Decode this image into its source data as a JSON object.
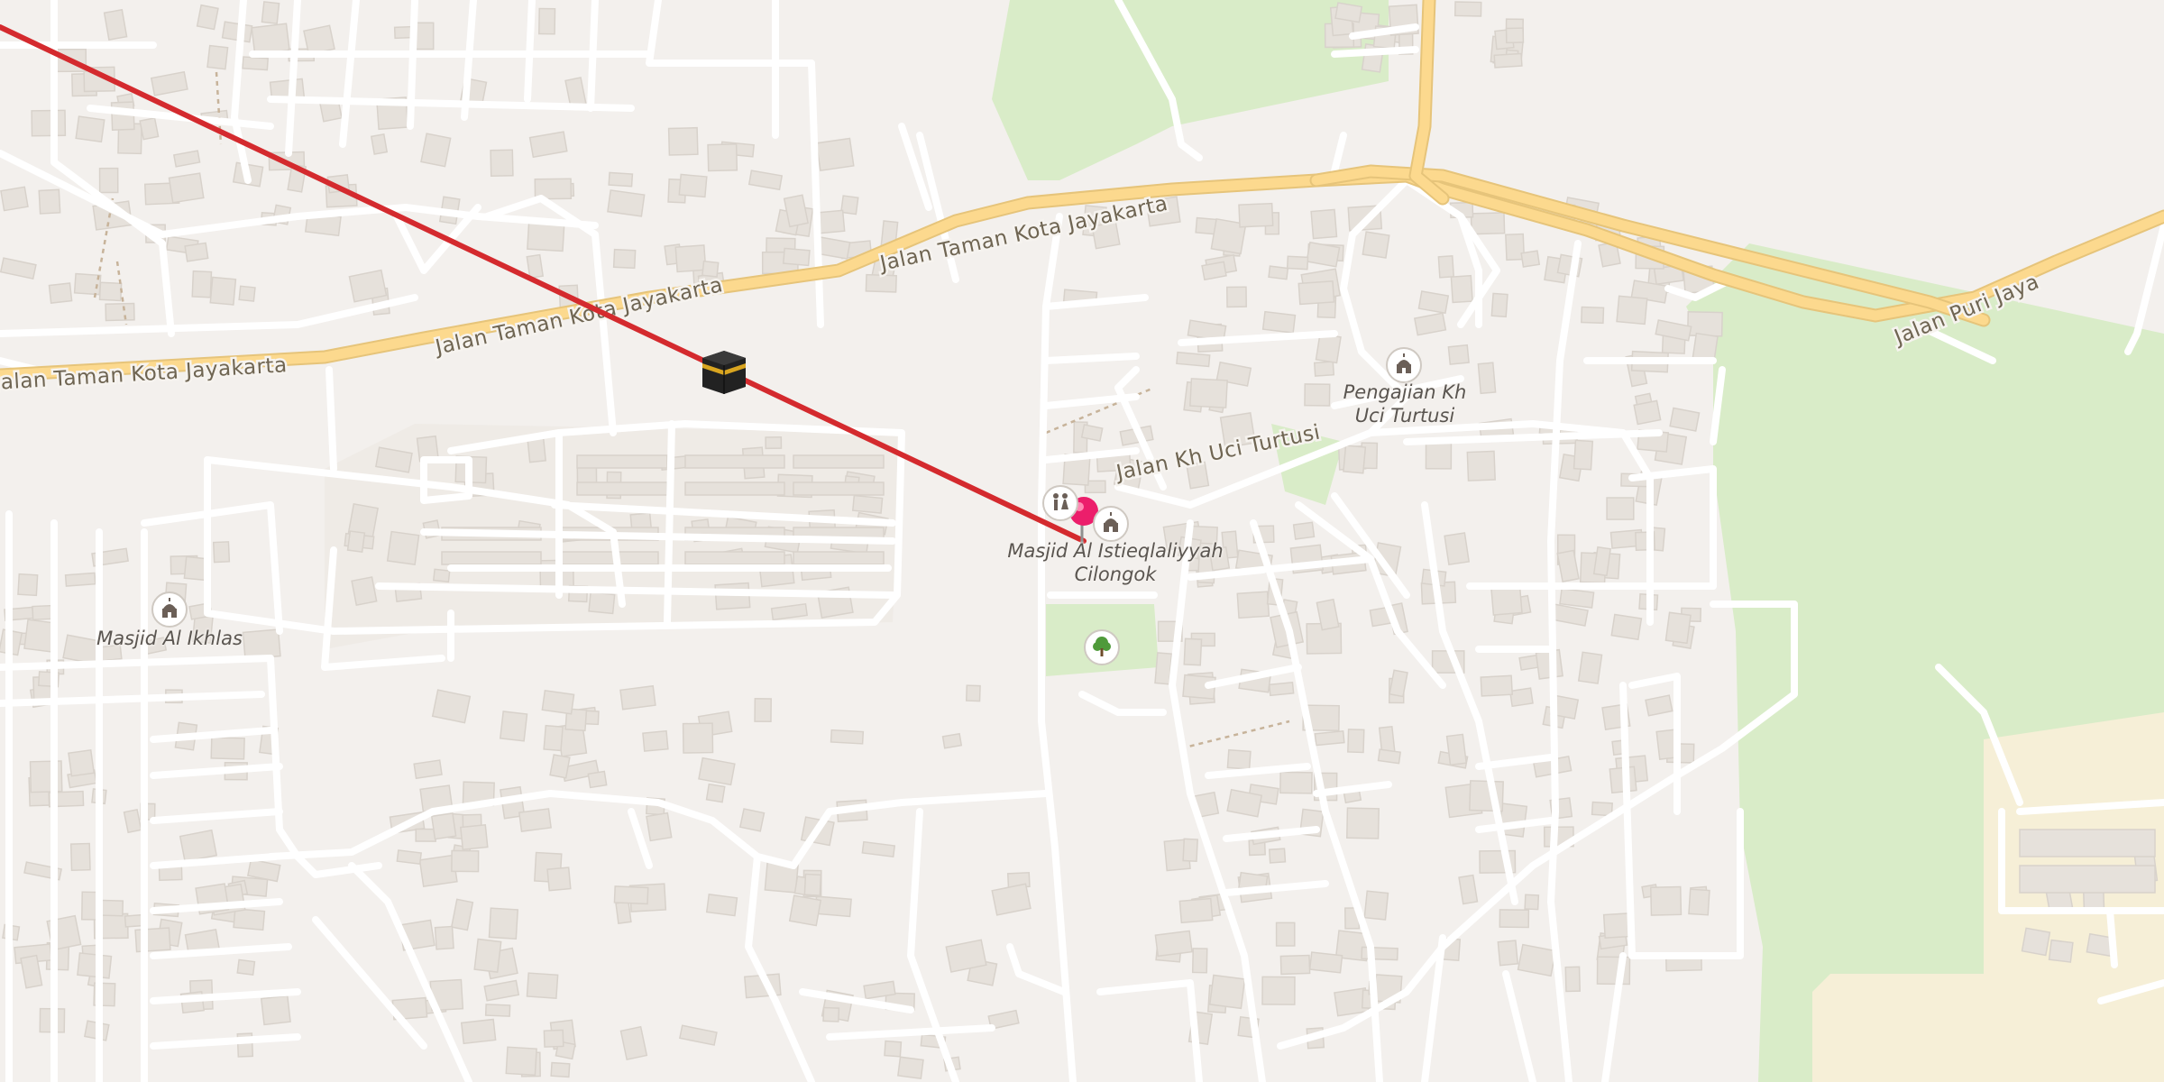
{
  "map": {
    "streets": [
      {
        "id": "taman-1",
        "name": "Jalan Taman Kota Jayakarta"
      },
      {
        "id": "taman-2",
        "name": "Jalan Taman Kota Jayakarta"
      },
      {
        "id": "taman-3",
        "name": "Jalan Taman Kota Jayakarta"
      },
      {
        "id": "uci",
        "name": "Jalan Kh Uci Turtusi"
      },
      {
        "id": "puri",
        "name": "Jalan Puri Jaya"
      }
    ],
    "pois": [
      {
        "id": "masjid-istieqlaliyyah",
        "line1": "Masjid Al Istieqlaliyyah",
        "line2": "Cilongok",
        "icon": "mosque-icon"
      },
      {
        "id": "pengajian",
        "line1": "Pengajian Kh",
        "line2": "Uci Turtusi",
        "icon": "mosque-icon"
      },
      {
        "id": "masjid-ikhlas",
        "line1": "Masjid Al Ikhlas",
        "line2": "",
        "icon": "mosque-icon"
      }
    ],
    "extra_icons": [
      "toilets-icon",
      "park-tree-icon"
    ],
    "overlay": {
      "qibla_line_color": "#d42a2e",
      "kaaba_icon": "kaaba-icon",
      "location_pin": "location-pin-icon",
      "pin_color": "#ec1e6b"
    },
    "colors": {
      "background": "#f3f0ed",
      "primary_road": "#fcd98e",
      "park": "#d9ecc8",
      "building": "#e6e1db"
    }
  }
}
